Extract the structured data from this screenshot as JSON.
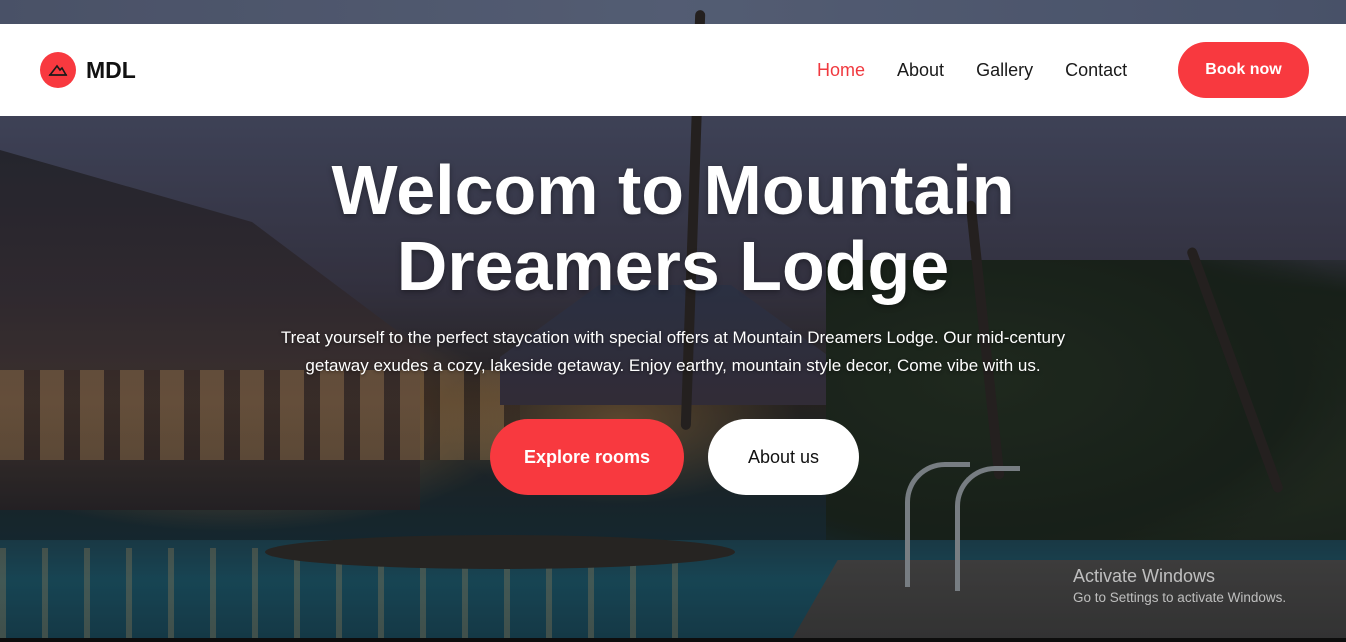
{
  "brand": {
    "name": "MDL"
  },
  "nav": {
    "links": [
      {
        "label": "Home",
        "active": true
      },
      {
        "label": "About",
        "active": false
      },
      {
        "label": "Gallery",
        "active": false
      },
      {
        "label": "Contact",
        "active": false
      }
    ],
    "cta_label": "Book now"
  },
  "hero": {
    "title_line1": "Welcom to Mountain",
    "title_line2": "Dreamers Lodge",
    "subtitle_line1": "Treat yourself to the perfect staycation with special offers at Mountain Dreamers Lodge. Our mid-century",
    "subtitle_line2": "getaway exudes a cozy, lakeside getaway. Enjoy earthy, mountain style decor, Come vibe with us.",
    "primary_button": "Explore rooms",
    "secondary_button": "About us"
  },
  "watermark": {
    "title": "Activate Windows",
    "subtitle": "Go to Settings to activate Windows."
  },
  "colors": {
    "accent": "#f8393f",
    "active_link": "#f0393f",
    "navbar_bg": "#ffffff"
  },
  "icons": {
    "logo": "mountain-logo-icon"
  }
}
